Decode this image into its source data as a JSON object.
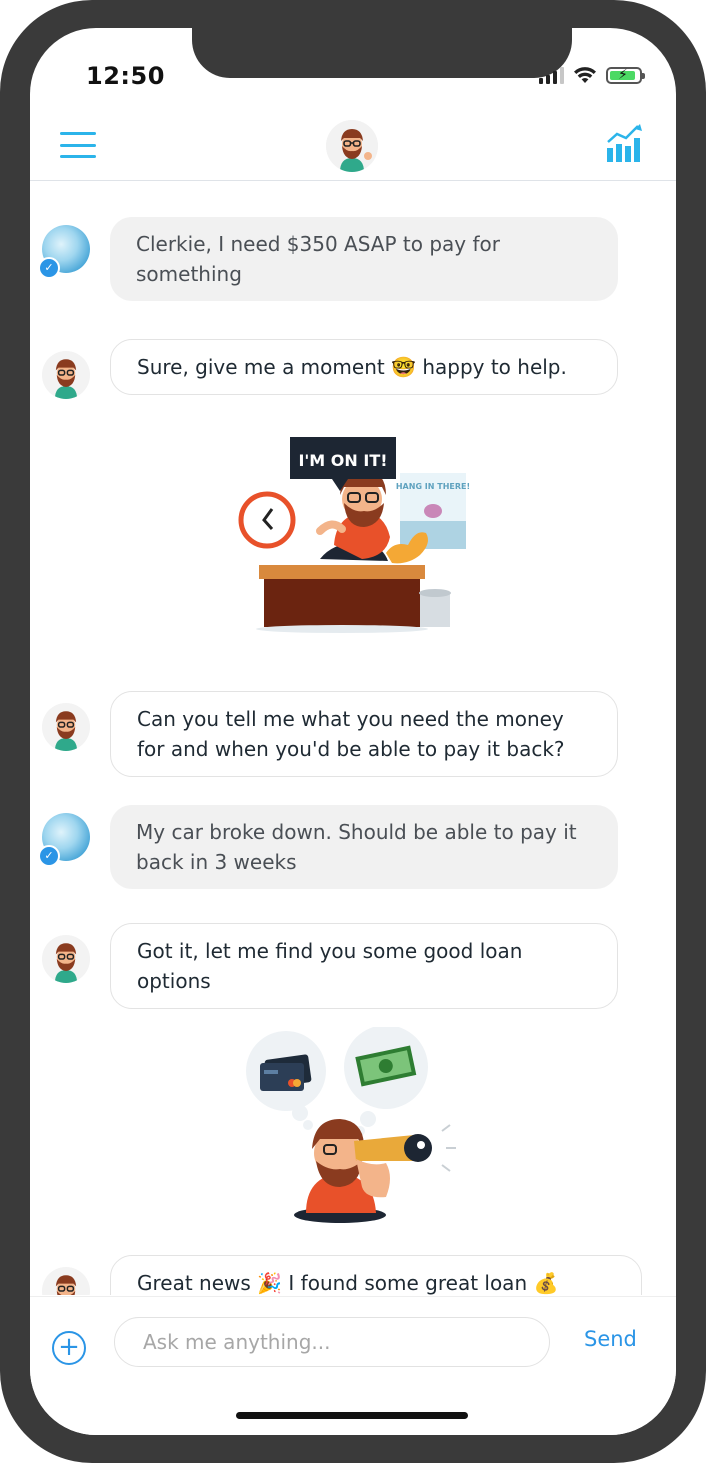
{
  "status_bar": {
    "time": "12:50"
  },
  "header": {
    "menu_icon": "hamburger-menu-icon",
    "avatar_icon": "clerkie-avatar",
    "stats_icon": "bar-chart-trend-icon"
  },
  "messages": [
    {
      "sender": "user",
      "text": "Clerkie, I need $350 ASAP to pay for something"
    },
    {
      "sender": "bot",
      "text": "Sure, give me a moment 🤓 happy to help."
    },
    {
      "sender": "bot",
      "text": "Can you tell me what you need the money for and when you'd be able to pay it back?"
    },
    {
      "sender": "user",
      "text": "My car broke down. Should be able to pay it back in 3 weeks"
    },
    {
      "sender": "bot",
      "text": "Got it, let me find you some good loan options"
    },
    {
      "sender": "bot",
      "text": "Great news 🎉 I found some great loan 💰 options"
    }
  ],
  "illustrations": {
    "working": {
      "speech": "I'M ON IT!",
      "poster": "HANG IN THERE!"
    },
    "searching": {
      "thought_icons": [
        "credit-card-icon",
        "cash-bill-icon"
      ]
    }
  },
  "input": {
    "placeholder": "Ask me anything...",
    "send_label": "Send"
  },
  "colors": {
    "accent": "#2b95e6",
    "header_icon": "#2bb4ea",
    "user_bubble": "#f1f1f1"
  }
}
